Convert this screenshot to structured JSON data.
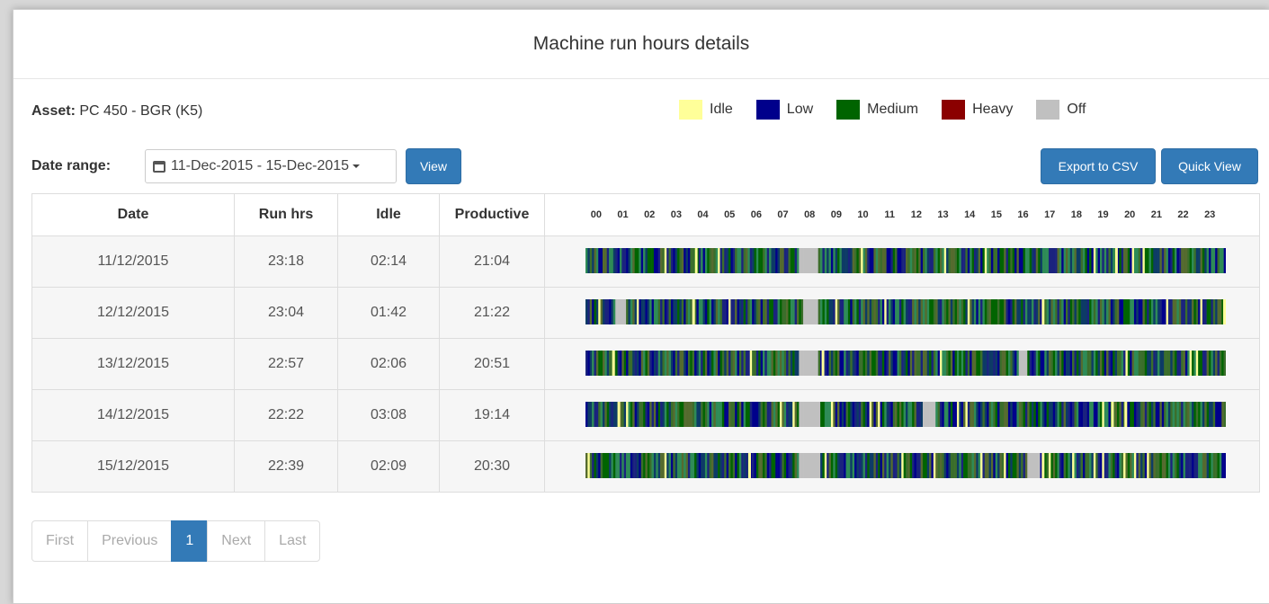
{
  "header": {
    "title": "Machine run hours details"
  },
  "asset": {
    "label": "Asset:",
    "value": "PC 450 - BGR (K5)"
  },
  "legend": [
    {
      "label": "Idle",
      "color": "#ffff99"
    },
    {
      "label": "Low",
      "color": "#00008b"
    },
    {
      "label": "Medium",
      "color": "#006400"
    },
    {
      "label": "Heavy",
      "color": "#8b0000"
    },
    {
      "label": "Off",
      "color": "#c0c0c0"
    }
  ],
  "date_range": {
    "label": "Date range:",
    "value": "11-Dec-2015 - 15-Dec-2015",
    "icon": "calendar-icon"
  },
  "buttons": {
    "view": "View",
    "export": "Export to CSV",
    "quick_view": "Quick View"
  },
  "table": {
    "columns": [
      "Date",
      "Run hrs",
      "Idle",
      "Productive"
    ],
    "hours": [
      "00",
      "01",
      "02",
      "03",
      "04",
      "05",
      "06",
      "07",
      "08",
      "09",
      "10",
      "11",
      "12",
      "13",
      "14",
      "15",
      "16",
      "17",
      "18",
      "19",
      "20",
      "21",
      "22",
      "23"
    ],
    "rows": [
      {
        "date": "11/12/2015",
        "run": "23:18",
        "idle": "02:14",
        "productive": "21:04",
        "off": [
          [
            8.0,
            8.7
          ]
        ],
        "idle_marks": [
          4.1,
          19.85
        ]
      },
      {
        "date": "12/12/2015",
        "run": "23:04",
        "idle": "01:42",
        "productive": "21:22",
        "off": [
          [
            1.1,
            1.5
          ],
          [
            8.1,
            8.7
          ]
        ],
        "idle_marks": [
          4.0,
          17.1,
          23.9
        ]
      },
      {
        "date": "13/12/2015",
        "run": "22:57",
        "idle": "02:06",
        "productive": "20:51",
        "off": [
          [
            8.0,
            8.7
          ],
          [
            16.2,
            16.5
          ]
        ],
        "idle_marks": [
          1.0,
          8.85
        ]
      },
      {
        "date": "14/12/2015",
        "run": "22:22",
        "idle": "03:08",
        "productive": "19:14",
        "off": [
          [
            8.0,
            8.8
          ],
          [
            12.6,
            13.1
          ]
        ],
        "idle_marks": [
          1.2,
          19.7,
          20.2
        ]
      },
      {
        "date": "15/12/2015",
        "run": "22:39",
        "idle": "02:09",
        "productive": "20:30",
        "off": [
          [
            8.0,
            8.8
          ],
          [
            16.5,
            17.0
          ]
        ],
        "idle_marks": [
          6.1,
          17.1
        ]
      }
    ]
  },
  "pagination": {
    "first": "First",
    "previous": "Previous",
    "current": "1",
    "next": "Next",
    "last": "Last"
  }
}
